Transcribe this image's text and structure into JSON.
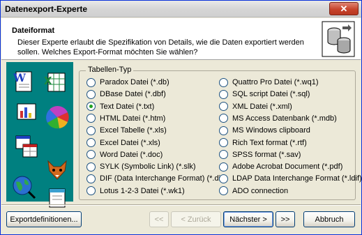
{
  "window": {
    "title": "Datenexport-Experte",
    "close_label": "✕"
  },
  "header": {
    "title": "Dateiformat",
    "description": "Dieser Experte erlaubt die Spezifikation von Details, wie die Daten exportiert werden sollen. Welches Export-Format möchten Sie wählen?"
  },
  "group": {
    "title": "Tabellen-Typ"
  },
  "formats_left": [
    {
      "label": "Paradox Datei (*.db)",
      "checked": false
    },
    {
      "label": "DBase Datei (*.dbf)",
      "checked": false
    },
    {
      "label": "Text Datei (*.txt)",
      "checked": true
    },
    {
      "label": "HTML Datei (*.htm)",
      "checked": false
    },
    {
      "label": "Excel Tabelle (*.xls)",
      "checked": false
    },
    {
      "label": "Excel Datei (*.xls)",
      "checked": false
    },
    {
      "label": "Word Datei (*.doc)",
      "checked": false
    },
    {
      "label": "SYLK (Symbolic Link) (*.slk)",
      "checked": false
    },
    {
      "label": "DIF (Data Interchange Format) (*.dif)",
      "checked": false
    },
    {
      "label": "Lotus 1-2-3 Datei (*.wk1)",
      "checked": false
    }
  ],
  "formats_right": [
    {
      "label": "Quattro Pro Datei (*.wq1)",
      "checked": false
    },
    {
      "label": "SQL script Datei (*.sql)",
      "checked": false
    },
    {
      "label": "XML Datei (*.xml)",
      "checked": false
    },
    {
      "label": "MS Access Datenbank (*.mdb)",
      "checked": false
    },
    {
      "label": "MS Windows clipboard",
      "checked": false
    },
    {
      "label": "Rich Text format (*.rtf)",
      "checked": false
    },
    {
      "label": "SPSS format (*.sav)",
      "checked": false
    },
    {
      "label": "Adobe Acrobat Document (*.pdf)",
      "checked": false
    },
    {
      "label": "LDAP Data Interchange Format (*.ldif)",
      "checked": false
    },
    {
      "label": "ADO connection",
      "checked": false
    }
  ],
  "buttons": {
    "export_definitions": "Exportdefinitionen...",
    "first": "<<",
    "back": "< Zurück",
    "next": "Nächster >",
    "last": ">>",
    "cancel": "Abbruch"
  }
}
